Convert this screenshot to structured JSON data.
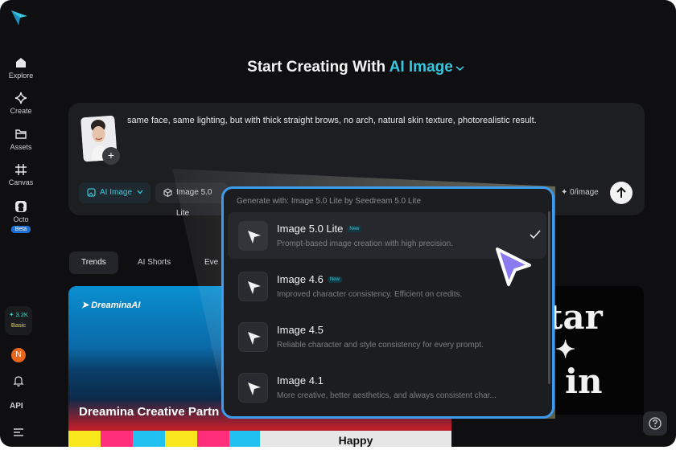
{
  "app": {
    "title_prefix": "Start Creating With",
    "title_accent": "AI Image"
  },
  "sidebar": {
    "items": [
      {
        "label": "Explore",
        "icon": "home-icon"
      },
      {
        "label": "Create",
        "icon": "sparkle-icon"
      },
      {
        "label": "Assets",
        "icon": "folder-icon"
      },
      {
        "label": "Canvas",
        "icon": "canvas-icon"
      },
      {
        "label": "Octo",
        "icon": "octo-icon",
        "badge": "Beta"
      }
    ],
    "credits": {
      "amount": "3.2K",
      "plan": "Basic"
    },
    "avatar_initial": "N",
    "api_label": "API"
  },
  "prompt": {
    "text": "same face, same lighting, but with thick straight brows, no arch, natural skin texture, photorealistic result.",
    "mode_chip": "AI Image",
    "model_chip": "Image 5.0 Lite",
    "cost": "0/image"
  },
  "tabs": [
    "Trends",
    "AI Shorts",
    "Eve"
  ],
  "gallery": {
    "left_watermark": "DreaminaAI",
    "left_title": "Dreamina Creative Partn",
    "right_lines": [
      "tar",
      "✦",
      "in"
    ],
    "strip_text": "Happy"
  },
  "dropdown": {
    "header": "Generate with: Image 5.0 Lite by Seedream 5.0 Lite",
    "new_badge": "New",
    "options": [
      {
        "name": "Image 5.0 Lite",
        "is_new": true,
        "desc": "Prompt-based image creation with high precision.",
        "selected": true
      },
      {
        "name": "Image 4.6",
        "is_new": true,
        "desc": "Improved character consistency. Efficient on credits.",
        "selected": false
      },
      {
        "name": "Image 4.5",
        "is_new": false,
        "desc": "Reliable character and style consistency for every prompt.",
        "selected": false
      },
      {
        "name": "Image 4.1",
        "is_new": false,
        "desc": "More creative, better aesthetics, and always consistent char...",
        "selected": false
      }
    ]
  },
  "colors": {
    "accent": "#37c6de",
    "dropdown_border": "#3e9bf0",
    "cursor": "#8a7bf0",
    "bg": "#0f0f11"
  }
}
